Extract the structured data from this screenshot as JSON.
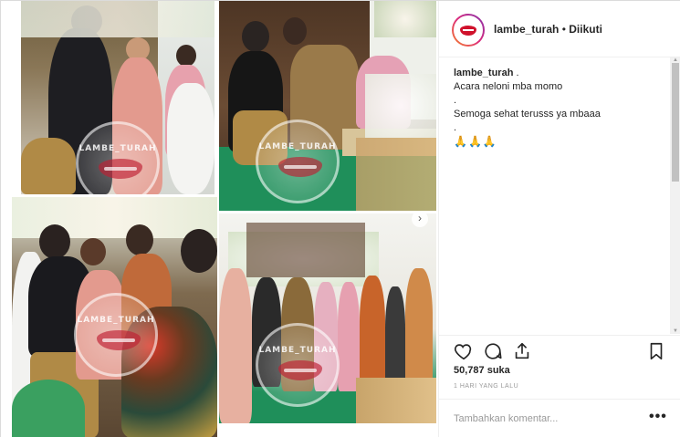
{
  "post": {
    "username": "lambe_turah",
    "separator": "•",
    "follow_status": "Diikuti"
  },
  "caption": {
    "username": "lambe_turah",
    "lines": [
      ".",
      "Acara neloni mba momo",
      ".",
      "Semoga sehat terusss ya mbaaa",
      "."
    ],
    "emoji": "🙏🙏🙏"
  },
  "stats": {
    "likes": "50,787 suka",
    "time": "1 HARI YANG LALU"
  },
  "comment": {
    "placeholder": "Tambahkan komentar..."
  },
  "watermark": "LAMBE_TURAH",
  "icons": [
    "heart-icon",
    "comment-icon",
    "share-icon",
    "bookmark-icon",
    "more-options-icon",
    "next-arrow-icon",
    "lips-logo-icon"
  ],
  "colors": {
    "accent_lips": "#d0122c",
    "floor_green": "#1f8f5a",
    "text": "#262626",
    "muted": "#999999"
  }
}
